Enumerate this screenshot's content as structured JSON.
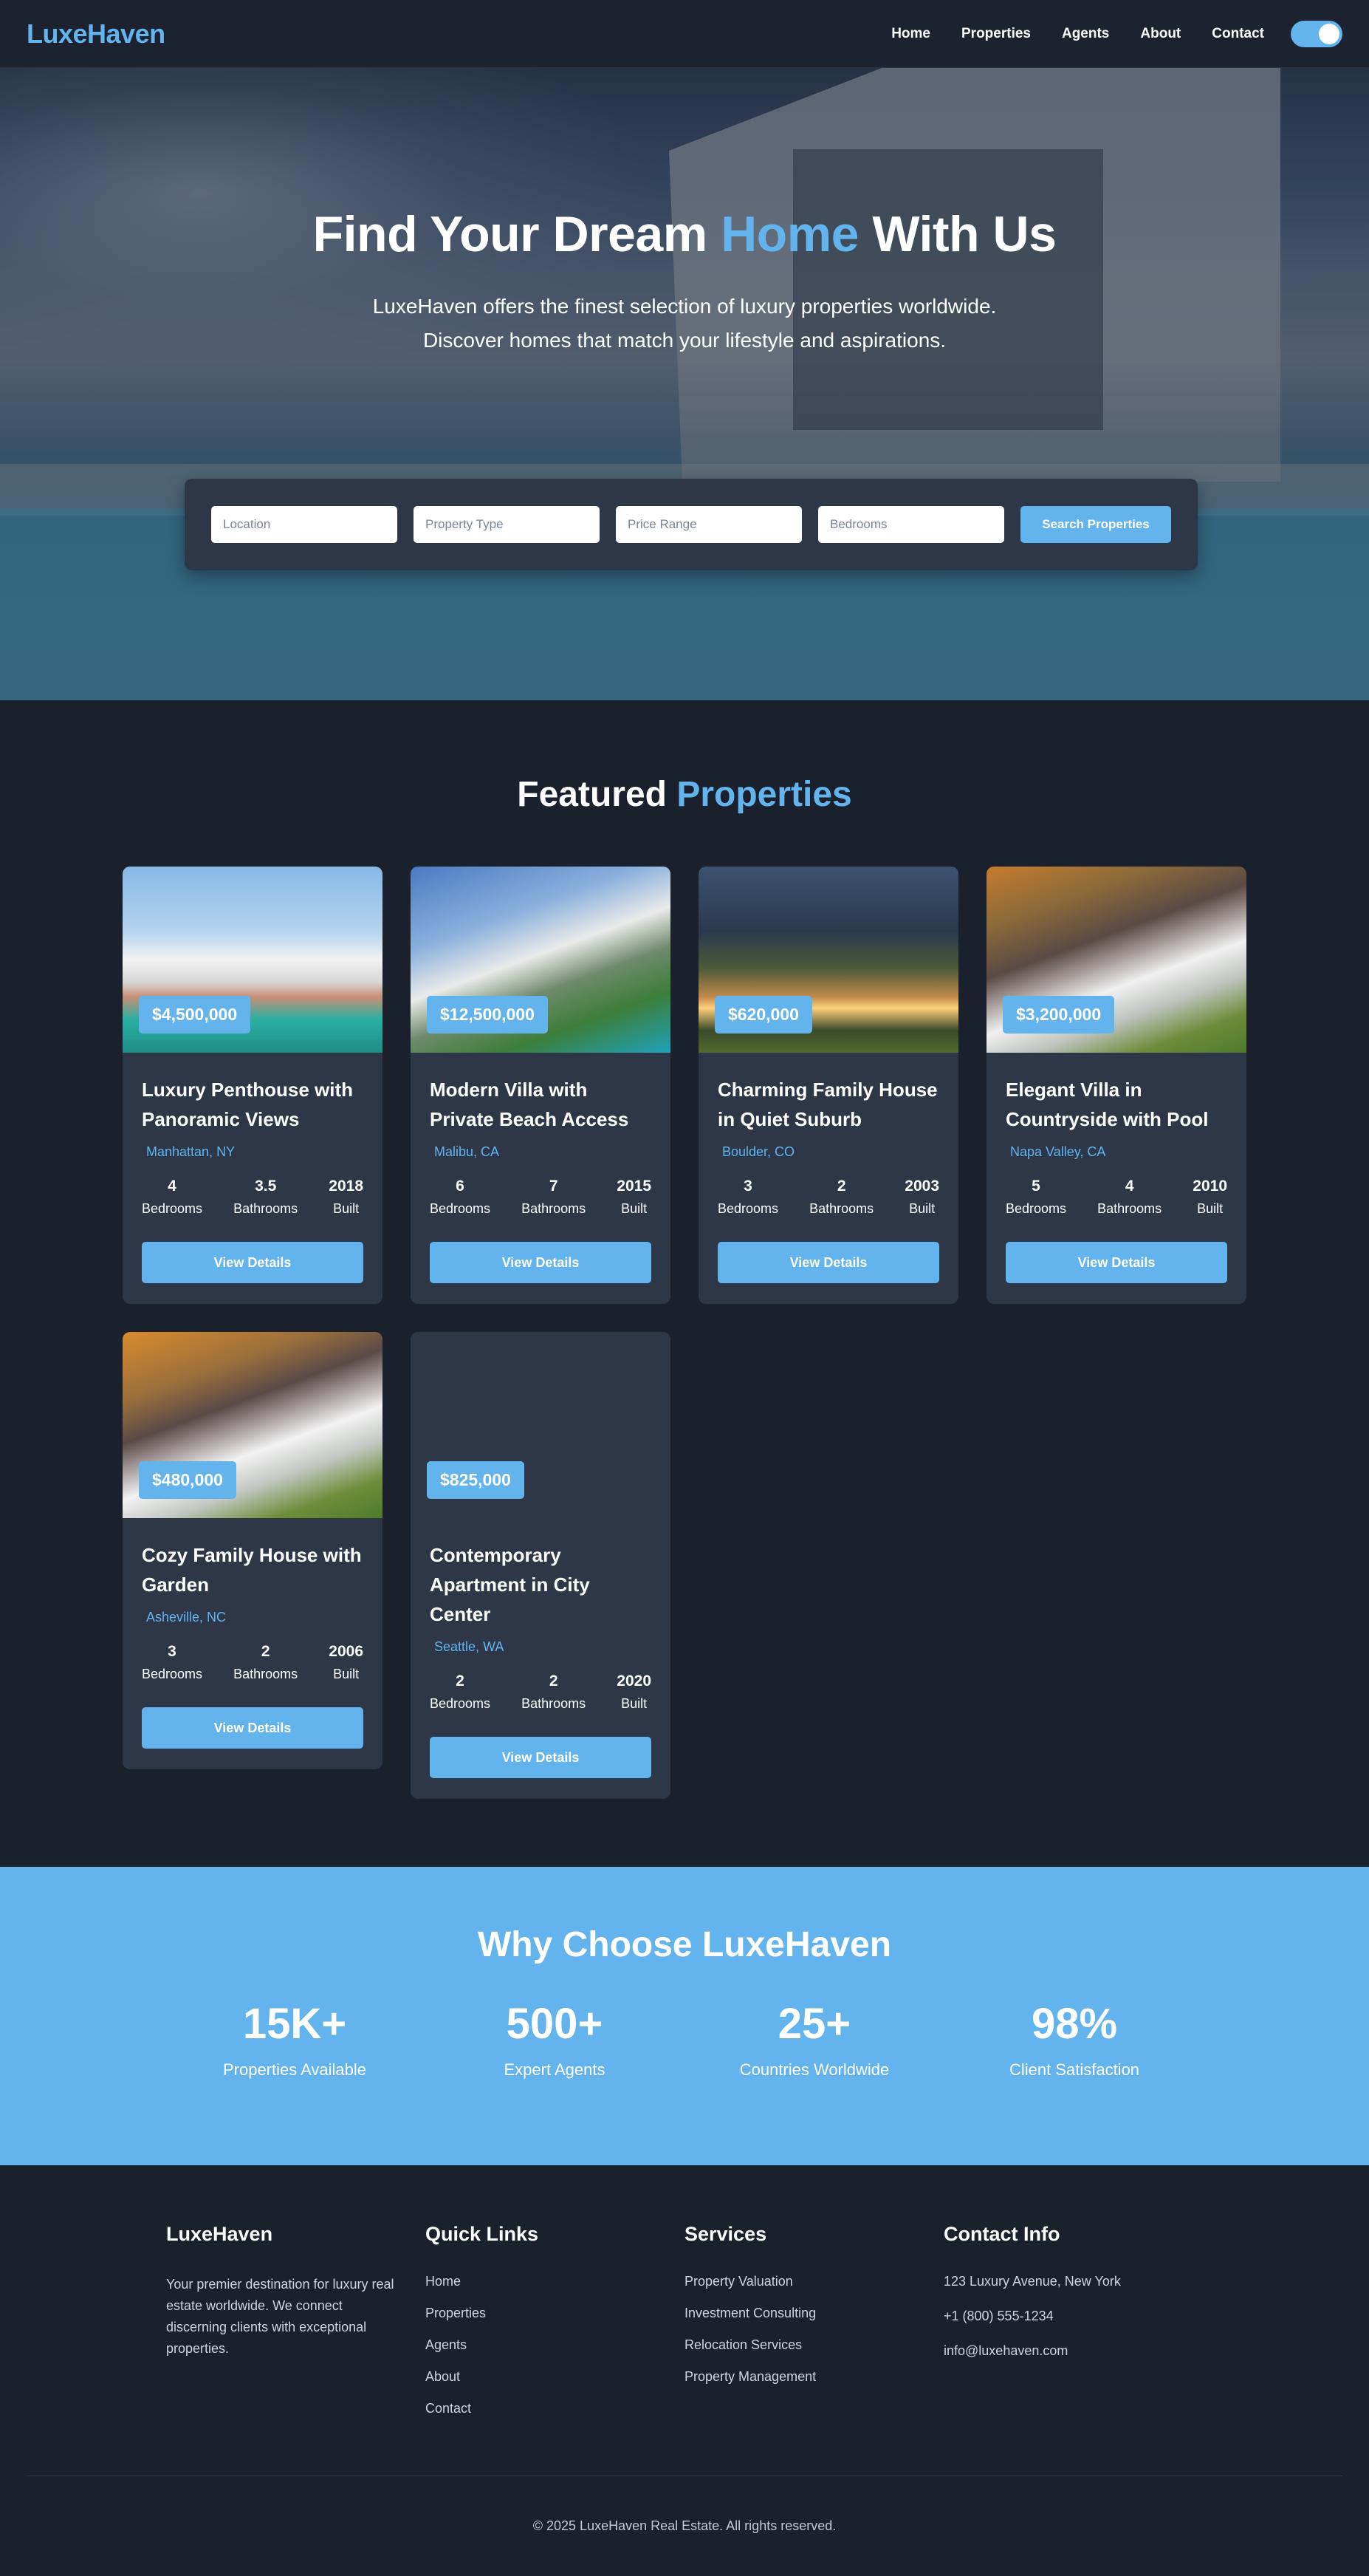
{
  "nav": {
    "logo": "LuxeHaven",
    "links": [
      "Home",
      "Properties",
      "Agents",
      "About",
      "Contact"
    ]
  },
  "hero": {
    "title_pre": "Find Your Dream ",
    "title_accent": "Home",
    "title_post": " With Us",
    "subtitle": "LuxeHaven offers the finest selection of luxury properties worldwide. Discover homes that match your lifestyle and aspirations.",
    "search": {
      "location_placeholder": "Location",
      "type_placeholder": "Property Type",
      "price_placeholder": "Price Range",
      "bedrooms_placeholder": "Bedrooms",
      "button": "Search Properties"
    }
  },
  "featured": {
    "title_pre": "Featured ",
    "title_accent": "Properties",
    "stat_labels": {
      "bedrooms": "Bedrooms",
      "bathrooms": "Bathrooms",
      "built": "Built"
    },
    "button": "View Details",
    "cards": [
      {
        "price": "$4,500,000",
        "title": "Luxury Penthouse with Panoramic Views",
        "location": "Manhattan, NY",
        "bedrooms": "4",
        "bathrooms": "3.5",
        "built": "2018"
      },
      {
        "price": "$12,500,000",
        "title": "Modern Villa with Private Beach Access",
        "location": "Malibu, CA",
        "bedrooms": "6",
        "bathrooms": "7",
        "built": "2015"
      },
      {
        "price": "$620,000",
        "title": "Charming Family House in Quiet Suburb",
        "location": "Boulder, CO",
        "bedrooms": "3",
        "bathrooms": "2",
        "built": "2003"
      },
      {
        "price": "$3,200,000",
        "title": "Elegant Villa in Countryside with Pool",
        "location": "Napa Valley, CA",
        "bedrooms": "5",
        "bathrooms": "4",
        "built": "2010"
      },
      {
        "price": "$480,000",
        "title": "Cozy Family House with Garden",
        "location": "Asheville, NC",
        "bedrooms": "3",
        "bathrooms": "2",
        "built": "2006"
      },
      {
        "price": "$825,000",
        "title": "Contemporary Apartment in City Center",
        "location": "Seattle, WA",
        "bedrooms": "2",
        "bathrooms": "2",
        "built": "2020"
      }
    ]
  },
  "why": {
    "title": "Why Choose LuxeHaven",
    "stats": [
      {
        "value": "15K+",
        "label": "Properties Available"
      },
      {
        "value": "500+",
        "label": "Expert Agents"
      },
      {
        "value": "25+",
        "label": "Countries Worldwide"
      },
      {
        "value": "98%",
        "label": "Client Satisfaction"
      }
    ]
  },
  "footer": {
    "brand_title": "LuxeHaven",
    "brand_text": "Your premier destination for luxury real estate worldwide. We connect discerning clients with exceptional properties.",
    "quick_title": "Quick Links",
    "quick_links": [
      "Home",
      "Properties",
      "Agents",
      "About",
      "Contact"
    ],
    "services_title": "Services",
    "services": [
      "Property Valuation",
      "Investment Consulting",
      "Relocation Services",
      "Property Management"
    ],
    "contact_title": "Contact Info",
    "contact": [
      "123 Luxury Avenue, New York",
      "+1 (800) 555-1234",
      "info@luxehaven.com"
    ],
    "copyright": "© 2025 LuxeHaven Real Estate. All rights reserved."
  },
  "colors": {
    "accent": "#63b3ed",
    "background": "#1a202c",
    "card": "#2d3748"
  }
}
